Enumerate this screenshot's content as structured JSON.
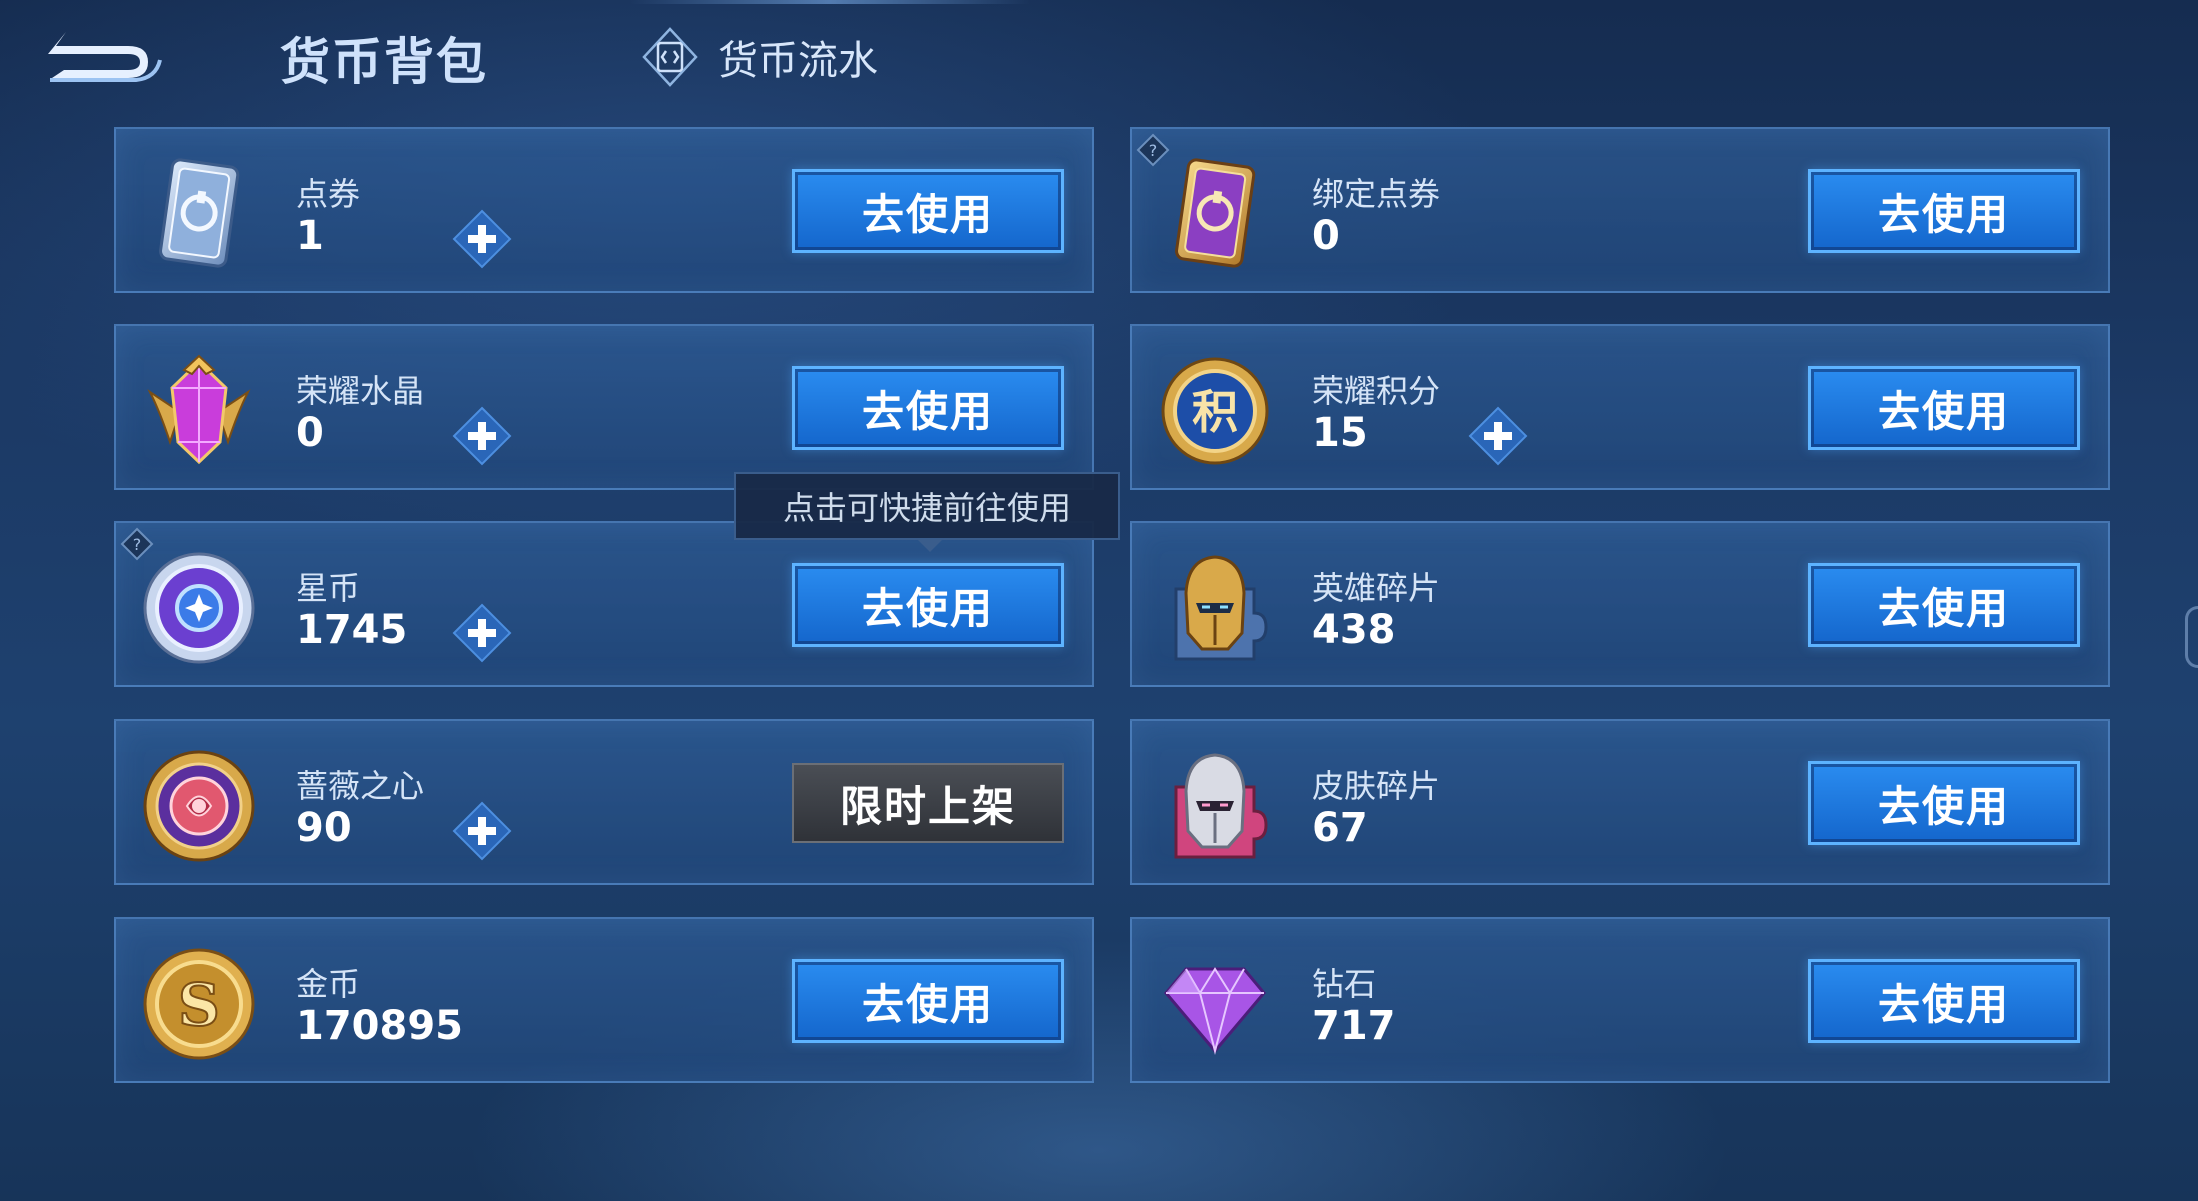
{
  "header": {
    "title": "货币背包",
    "history_tab": "货币流水"
  },
  "tooltip": "点击可快捷前往使用",
  "cards": [
    {
      "name": "点券",
      "amount": "1",
      "button": "去使用",
      "icon": "voucher-card-icon"
    },
    {
      "name": "绑定点券",
      "amount": "0",
      "button": "去使用",
      "icon": "bound-voucher-card-icon"
    },
    {
      "name": "荣耀水晶",
      "amount": "0",
      "button": "去使用",
      "icon": "glory-crystal-icon"
    },
    {
      "name": "荣耀积分",
      "amount": "15",
      "button": "去使用",
      "icon": "glory-points-icon",
      "icon_text": "积"
    },
    {
      "name": "星币",
      "amount": "1745",
      "button": "去使用",
      "icon": "star-coin-icon"
    },
    {
      "name": "英雄碎片",
      "amount": "438",
      "button": "去使用",
      "icon": "hero-fragment-icon"
    },
    {
      "name": "蔷薇之心",
      "amount": "90",
      "button": "限时上架",
      "icon": "rose-heart-icon"
    },
    {
      "name": "皮肤碎片",
      "amount": "67",
      "button": "去使用",
      "icon": "skin-fragment-icon"
    },
    {
      "name": "金币",
      "amount": "170895",
      "button": "去使用",
      "icon": "gold-coin-icon"
    },
    {
      "name": "钻石",
      "amount": "717",
      "button": "去使用",
      "icon": "diamond-icon"
    }
  ],
  "colors": {
    "accent_blue": "#1e7be0",
    "gold": "#d8a94a",
    "purple": "#9a3fd6"
  }
}
